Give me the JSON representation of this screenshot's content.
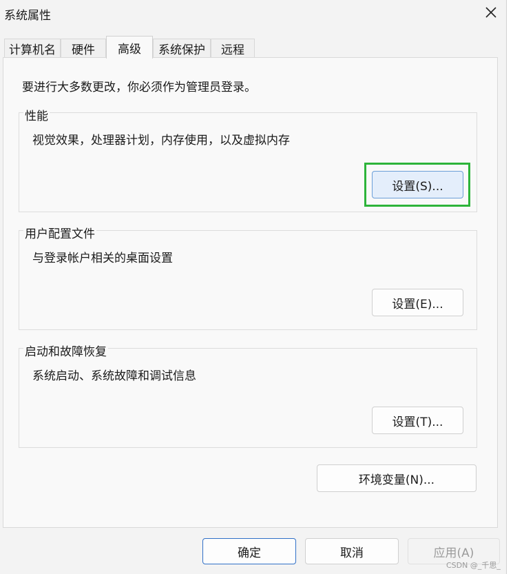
{
  "window": {
    "title": "系统属性",
    "close_icon": "close-icon"
  },
  "tabs": [
    {
      "label": "计算机名"
    },
    {
      "label": "硬件"
    },
    {
      "label": "高级",
      "active": true
    },
    {
      "label": "系统保护"
    },
    {
      "label": "远程"
    }
  ],
  "intro": "要进行大多数更改，你必须作为管理员登录。",
  "groups": {
    "performance": {
      "title": "性能",
      "desc": "视觉效果，处理器计划，内存使用，以及虚拟内存",
      "button": "设置(S)..."
    },
    "profile": {
      "title": "用户配置文件",
      "desc": "与登录帐户相关的桌面设置",
      "button": "设置(E)..."
    },
    "startup": {
      "title": "启动和故障恢复",
      "desc": "系统启动、系统故障和调试信息",
      "button": "设置(T)..."
    }
  },
  "env_button": "环境变量(N)...",
  "footer": {
    "ok": "确定",
    "cancel": "取消",
    "apply": "应用(A)"
  },
  "watermark": "CSDN @_千思_",
  "colors": {
    "highlight": "#2db43a",
    "focused_button": "#e4eefb",
    "primary_border": "#2f6fc7"
  }
}
